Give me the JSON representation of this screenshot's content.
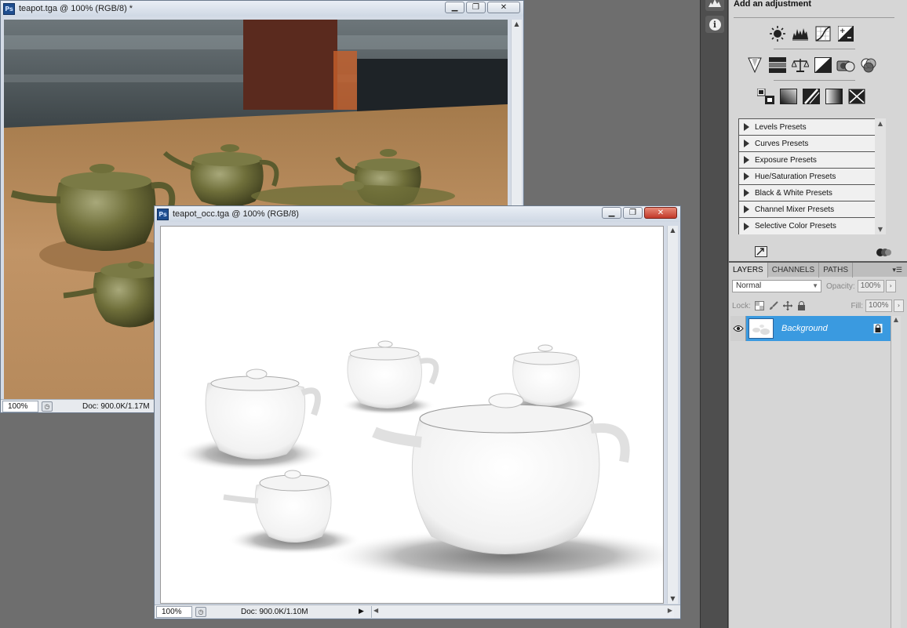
{
  "windows": {
    "back": {
      "title": "teapot.tga @ 100% (RGB/8) *",
      "zoom": "100%",
      "doc_info": "Doc: 900.0K/1.17M",
      "buttons": {
        "minimize": "▁",
        "restore": "❐",
        "close": "✕"
      }
    },
    "front": {
      "title": "teapot_occ.tga @ 100% (RGB/8)",
      "zoom": "100%",
      "doc_info": "Doc: 900.0K/1.10M",
      "buttons": {
        "minimize": "▁",
        "restore": "❐",
        "close": "✕"
      }
    }
  },
  "adjustments": {
    "title": "Add an adjustment",
    "presets": [
      "Levels Presets",
      "Curves Presets",
      "Exposure Presets",
      "Hue/Saturation Presets",
      "Black & White Presets",
      "Channel Mixer Presets",
      "Selective Color Presets"
    ]
  },
  "layers_panel": {
    "tabs": [
      "LAYERS",
      "CHANNELS",
      "PATHS"
    ],
    "active_tab": "LAYERS",
    "blend_mode": "Normal",
    "opacity_label": "Opacity:",
    "opacity_value": "100%",
    "lock_label": "Lock:",
    "fill_label": "Fill:",
    "fill_value": "100%",
    "layers": [
      {
        "name": "Background",
        "visible": true,
        "locked": true
      }
    ]
  },
  "colors": {
    "selection_blue": "#3a9ae0",
    "table_wood": "#b98a58",
    "teapot_olive": "#6f6f3a",
    "workspace_gray": "#6e6e6e"
  }
}
